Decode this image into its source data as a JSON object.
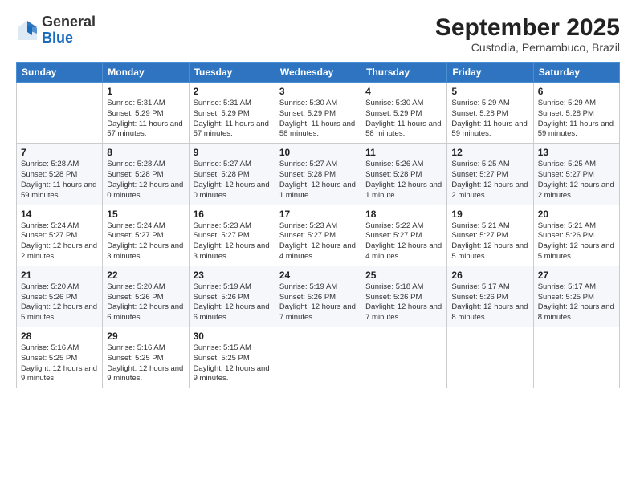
{
  "logo": {
    "line1": "General",
    "line2": "Blue"
  },
  "title": "September 2025",
  "subtitle": "Custodia, Pernambuco, Brazil",
  "days_of_week": [
    "Sunday",
    "Monday",
    "Tuesday",
    "Wednesday",
    "Thursday",
    "Friday",
    "Saturday"
  ],
  "weeks": [
    [
      {
        "day": "",
        "info": ""
      },
      {
        "day": "1",
        "info": "Sunrise: 5:31 AM\nSunset: 5:29 PM\nDaylight: 11 hours\nand 57 minutes."
      },
      {
        "day": "2",
        "info": "Sunrise: 5:31 AM\nSunset: 5:29 PM\nDaylight: 11 hours\nand 57 minutes."
      },
      {
        "day": "3",
        "info": "Sunrise: 5:30 AM\nSunset: 5:29 PM\nDaylight: 11 hours\nand 58 minutes."
      },
      {
        "day": "4",
        "info": "Sunrise: 5:30 AM\nSunset: 5:29 PM\nDaylight: 11 hours\nand 58 minutes."
      },
      {
        "day": "5",
        "info": "Sunrise: 5:29 AM\nSunset: 5:28 PM\nDaylight: 11 hours\nand 59 minutes."
      },
      {
        "day": "6",
        "info": "Sunrise: 5:29 AM\nSunset: 5:28 PM\nDaylight: 11 hours\nand 59 minutes."
      }
    ],
    [
      {
        "day": "7",
        "info": "Sunrise: 5:28 AM\nSunset: 5:28 PM\nDaylight: 11 hours\nand 59 minutes."
      },
      {
        "day": "8",
        "info": "Sunrise: 5:28 AM\nSunset: 5:28 PM\nDaylight: 12 hours\nand 0 minutes."
      },
      {
        "day": "9",
        "info": "Sunrise: 5:27 AM\nSunset: 5:28 PM\nDaylight: 12 hours\nand 0 minutes."
      },
      {
        "day": "10",
        "info": "Sunrise: 5:27 AM\nSunset: 5:28 PM\nDaylight: 12 hours\nand 1 minute."
      },
      {
        "day": "11",
        "info": "Sunrise: 5:26 AM\nSunset: 5:28 PM\nDaylight: 12 hours\nand 1 minute."
      },
      {
        "day": "12",
        "info": "Sunrise: 5:25 AM\nSunset: 5:27 PM\nDaylight: 12 hours\nand 2 minutes."
      },
      {
        "day": "13",
        "info": "Sunrise: 5:25 AM\nSunset: 5:27 PM\nDaylight: 12 hours\nand 2 minutes."
      }
    ],
    [
      {
        "day": "14",
        "info": "Sunrise: 5:24 AM\nSunset: 5:27 PM\nDaylight: 12 hours\nand 2 minutes."
      },
      {
        "day": "15",
        "info": "Sunrise: 5:24 AM\nSunset: 5:27 PM\nDaylight: 12 hours\nand 3 minutes."
      },
      {
        "day": "16",
        "info": "Sunrise: 5:23 AM\nSunset: 5:27 PM\nDaylight: 12 hours\nand 3 minutes."
      },
      {
        "day": "17",
        "info": "Sunrise: 5:23 AM\nSunset: 5:27 PM\nDaylight: 12 hours\nand 4 minutes."
      },
      {
        "day": "18",
        "info": "Sunrise: 5:22 AM\nSunset: 5:27 PM\nDaylight: 12 hours\nand 4 minutes."
      },
      {
        "day": "19",
        "info": "Sunrise: 5:21 AM\nSunset: 5:27 PM\nDaylight: 12 hours\nand 5 minutes."
      },
      {
        "day": "20",
        "info": "Sunrise: 5:21 AM\nSunset: 5:26 PM\nDaylight: 12 hours\nand 5 minutes."
      }
    ],
    [
      {
        "day": "21",
        "info": "Sunrise: 5:20 AM\nSunset: 5:26 PM\nDaylight: 12 hours\nand 5 minutes."
      },
      {
        "day": "22",
        "info": "Sunrise: 5:20 AM\nSunset: 5:26 PM\nDaylight: 12 hours\nand 6 minutes."
      },
      {
        "day": "23",
        "info": "Sunrise: 5:19 AM\nSunset: 5:26 PM\nDaylight: 12 hours\nand 6 minutes."
      },
      {
        "day": "24",
        "info": "Sunrise: 5:19 AM\nSunset: 5:26 PM\nDaylight: 12 hours\nand 7 minutes."
      },
      {
        "day": "25",
        "info": "Sunrise: 5:18 AM\nSunset: 5:26 PM\nDaylight: 12 hours\nand 7 minutes."
      },
      {
        "day": "26",
        "info": "Sunrise: 5:17 AM\nSunset: 5:26 PM\nDaylight: 12 hours\nand 8 minutes."
      },
      {
        "day": "27",
        "info": "Sunrise: 5:17 AM\nSunset: 5:25 PM\nDaylight: 12 hours\nand 8 minutes."
      }
    ],
    [
      {
        "day": "28",
        "info": "Sunrise: 5:16 AM\nSunset: 5:25 PM\nDaylight: 12 hours\nand 9 minutes."
      },
      {
        "day": "29",
        "info": "Sunrise: 5:16 AM\nSunset: 5:25 PM\nDaylight: 12 hours\nand 9 minutes."
      },
      {
        "day": "30",
        "info": "Sunrise: 5:15 AM\nSunset: 5:25 PM\nDaylight: 12 hours\nand 9 minutes."
      },
      {
        "day": "",
        "info": ""
      },
      {
        "day": "",
        "info": ""
      },
      {
        "day": "",
        "info": ""
      },
      {
        "day": "",
        "info": ""
      }
    ]
  ]
}
